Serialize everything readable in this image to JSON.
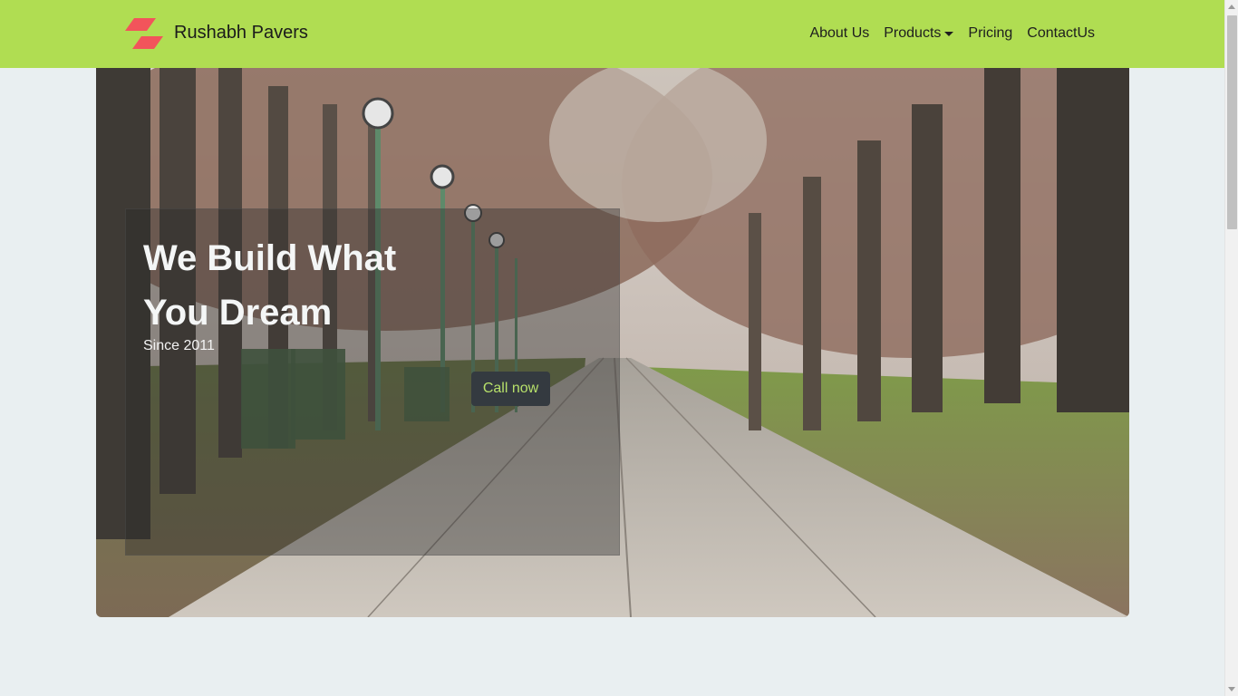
{
  "brand": {
    "name": "Rushabh Pavers",
    "logo_icon": "red-stripes-logo-icon",
    "logo_color": "#f2545b"
  },
  "nav": {
    "items": [
      {
        "label": "About Us"
      },
      {
        "label": "Products",
        "dropdown": true
      },
      {
        "label": "Pricing"
      },
      {
        "label": "ContactUs"
      }
    ]
  },
  "hero": {
    "title": "We Build What You Dream",
    "subtitle": "Since 2011",
    "cta_label": "Call now",
    "background": "tree-lined park path with lamp posts and benches"
  },
  "colors": {
    "navbar_bg": "#b0dd52",
    "page_bg": "#e9eff1",
    "button_bg": "#343a40",
    "button_text": "#b7e06a"
  }
}
